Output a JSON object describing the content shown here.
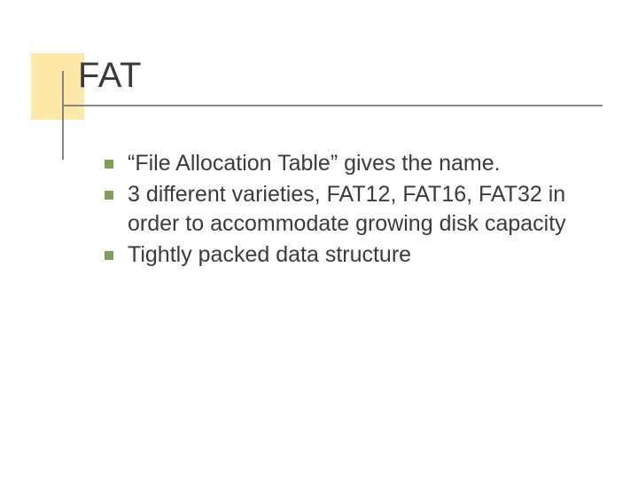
{
  "slide": {
    "title": "FAT",
    "bullets": [
      "“File Allocation Table” gives the name.",
      "3 different varieties, FAT12, FAT16, FAT32 in order to accommodate growing disk capacity",
      "Tightly packed data structure"
    ]
  }
}
